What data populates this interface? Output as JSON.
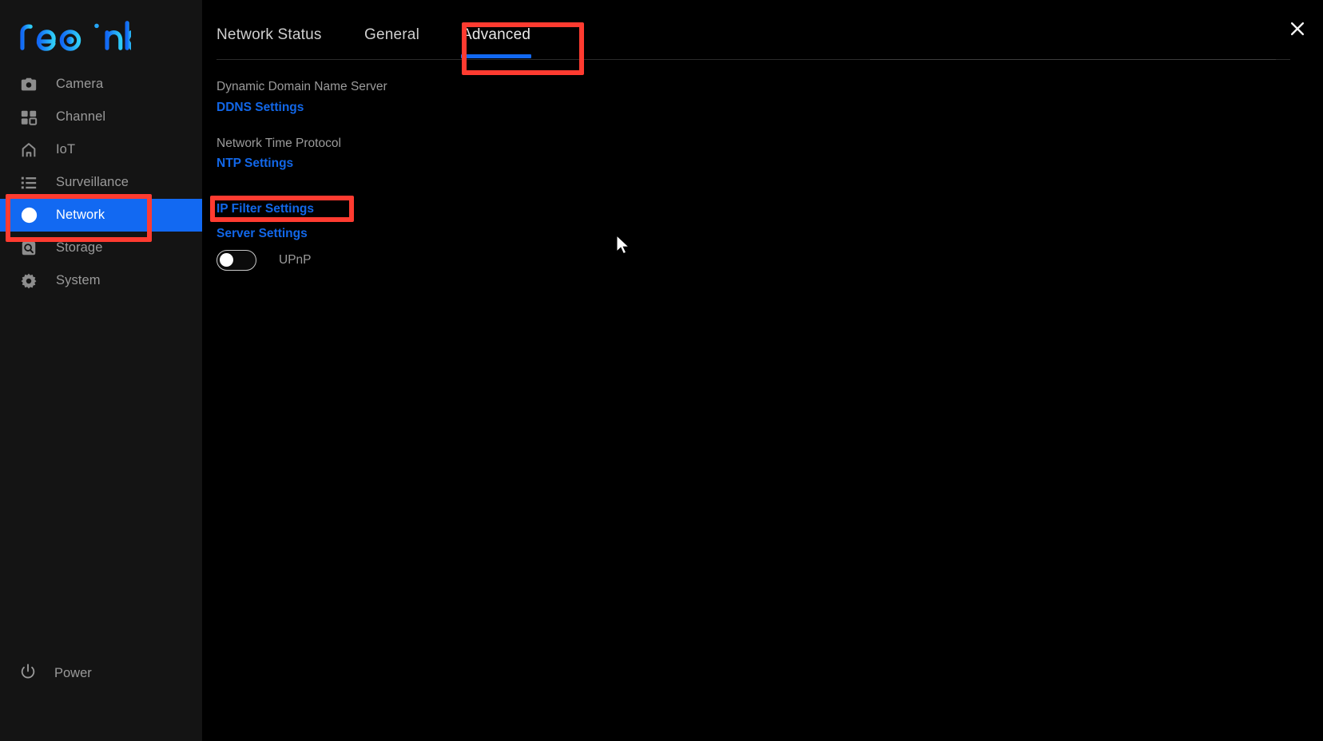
{
  "brand": {
    "name": "reolink",
    "logo_gradient_from": "#1268F5",
    "logo_gradient_to": "#2AC8F5"
  },
  "colors": {
    "accent_blue": "#1269F2",
    "link_blue": "#1267E8",
    "label_gray": "#9b9b9b",
    "sidebar_bg": "#141414",
    "content_bg": "#000000",
    "annotation_red": "#FF3B30"
  },
  "sidebar": {
    "items": [
      {
        "label": "Camera",
        "icon": "camera-icon",
        "active": false
      },
      {
        "label": "Channel",
        "icon": "grid-icon",
        "active": false
      },
      {
        "label": "IoT",
        "icon": "home-icon",
        "active": false
      },
      {
        "label": "Surveillance",
        "icon": "list-icon",
        "active": false
      },
      {
        "label": "Network",
        "icon": "globe-icon",
        "active": true
      },
      {
        "label": "Storage",
        "icon": "hard-drive-icon",
        "active": false
      },
      {
        "label": "System",
        "icon": "gear-icon",
        "active": false
      }
    ],
    "power": {
      "label": "Power",
      "icon": "power-icon"
    }
  },
  "tabs": [
    {
      "label": "Network Status",
      "active": false
    },
    {
      "label": "General",
      "active": false
    },
    {
      "label": "Advanced",
      "active": true
    }
  ],
  "content": {
    "sections": [
      {
        "group_label": "Dynamic Domain Name Server",
        "link": "DDNS Settings"
      },
      {
        "group_label": "Network Time Protocol",
        "link": "NTP Settings"
      }
    ],
    "standalone_links": [
      "IP Filter Settings",
      "Server Settings"
    ],
    "upnp": {
      "label": "UPnP",
      "enabled": false
    }
  },
  "window": {
    "close_label": "✕"
  },
  "annotations": [
    {
      "target": "sidebar-item-network"
    },
    {
      "target": "tab-advanced"
    },
    {
      "target": "link-ip-filter-settings"
    }
  ]
}
